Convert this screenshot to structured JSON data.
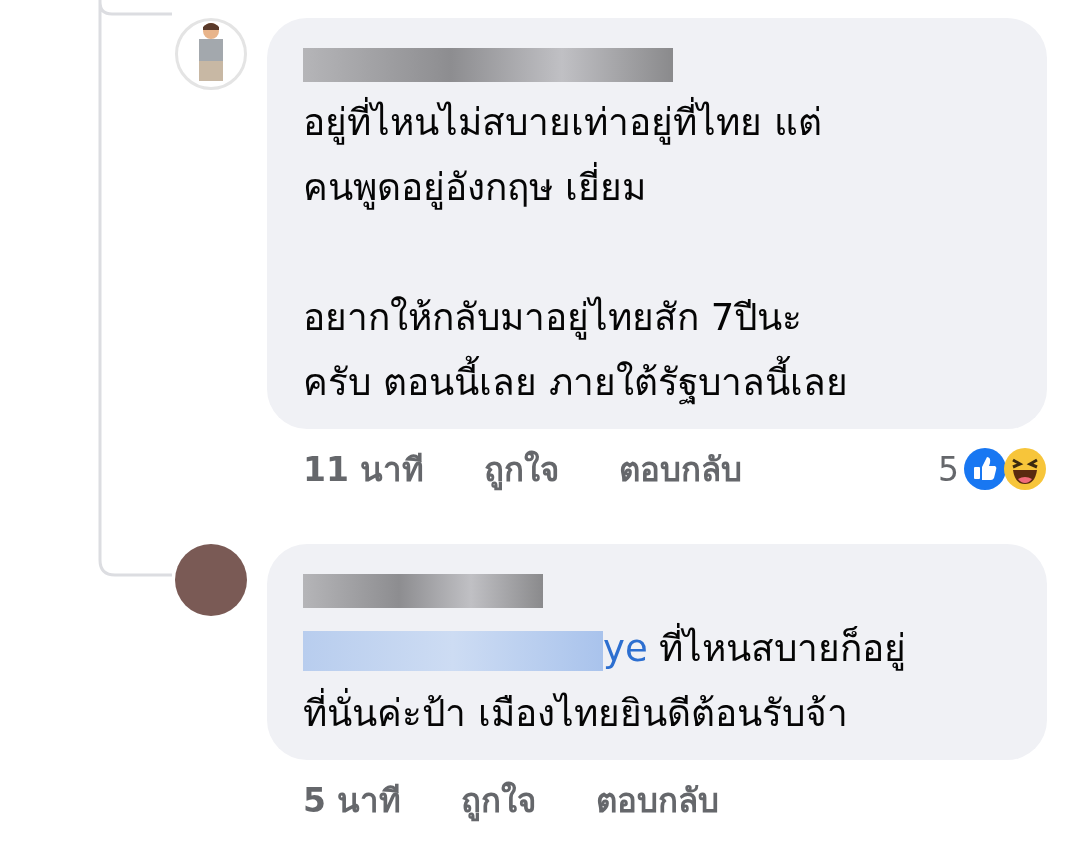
{
  "comments": [
    {
      "avatar": {
        "kind": "cartoon"
      },
      "text": "อยู่ที่ไหนไม่สบายเท่าอยู่ที่ไทย แต่\nคนพูดอยู่อังกฤษ เยี่ยม\n\nอยากให้กลับมาอยู่ไทยสัก 7ปีนะ\nครับ ตอนนี้เลย ภายใต้รัฐบาลนี้เลย",
      "time": "11 นาที",
      "like": "ถูกใจ",
      "reply": "ตอบกลับ",
      "reaction_count": "5",
      "reactions": [
        {
          "kind": "like"
        },
        {
          "kind": "haha"
        }
      ]
    },
    {
      "avatar": {
        "kind": "photo"
      },
      "mention": "ye",
      "text": "ที่ไหนสบายก็อยู่\nที่นั่นค่ะป้า เมืองไทยยินดีต้อนรับจ้า",
      "time": "5 นาที",
      "like": "ถูกใจ",
      "reply": "ตอบกลับ"
    }
  ]
}
